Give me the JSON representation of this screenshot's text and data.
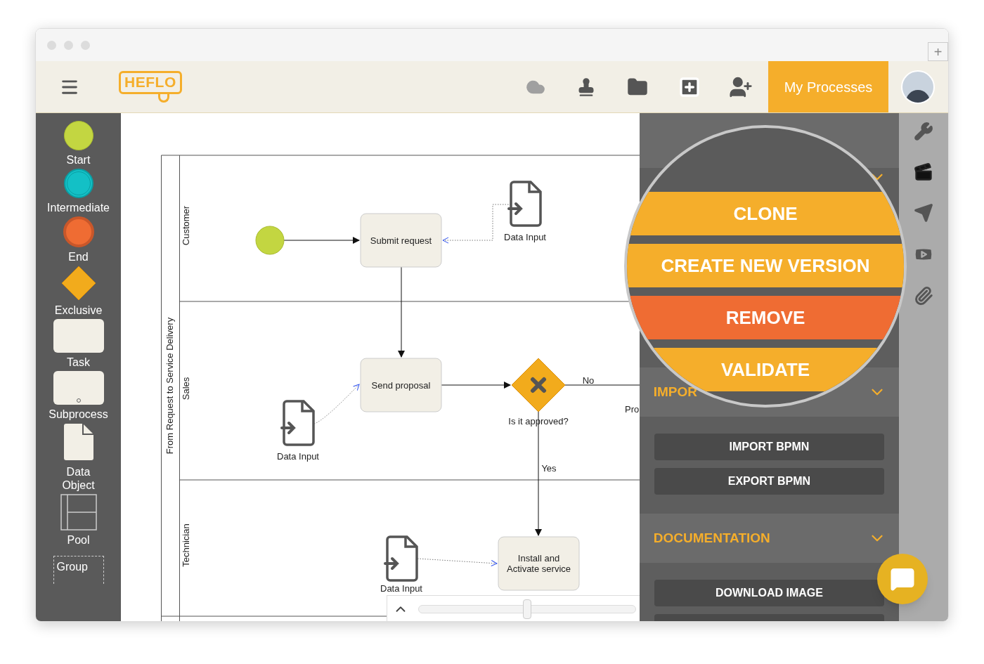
{
  "window": {
    "new_tab": "+"
  },
  "header": {
    "logo": "HEFLO",
    "primary_button": "My Processes"
  },
  "palette": [
    {
      "kind": "start",
      "label": "Start"
    },
    {
      "kind": "intermediate",
      "label": "Intermediate"
    },
    {
      "kind": "end",
      "label": "End"
    },
    {
      "kind": "gateway",
      "label": "Exclusive"
    },
    {
      "kind": "task",
      "label": "Task"
    },
    {
      "kind": "subprocess",
      "label": "Subprocess"
    },
    {
      "kind": "data",
      "label": "Data Object"
    },
    {
      "kind": "pool",
      "label": "Pool"
    },
    {
      "kind": "group",
      "label": "Group"
    }
  ],
  "diagram": {
    "pool": "From Request to Service Delivery",
    "lanes": [
      "Customer",
      "Sales",
      "Technician"
    ],
    "nodes": [
      {
        "kind": "start"
      },
      {
        "kind": "task",
        "label": "Submit request"
      },
      {
        "kind": "data",
        "label": "Data Input"
      },
      {
        "kind": "task",
        "label": "Send proposal"
      },
      {
        "kind": "gateway",
        "label": "Is it approved?"
      },
      {
        "kind": "data",
        "label": "Data Input"
      },
      {
        "kind": "task",
        "label": "Install and Activate service"
      },
      {
        "kind": "data",
        "label": "Data Input"
      }
    ],
    "flow_labels": [
      "No",
      "Pro",
      "Yes"
    ],
    "zoom": {
      "level": 0.5
    }
  },
  "panel": {
    "magnifier_actions": [
      {
        "kind": "primary",
        "label": "CLONE"
      },
      {
        "kind": "primary",
        "label": "CREATE NEW VERSION"
      },
      {
        "kind": "danger",
        "label": "REMOVE"
      },
      {
        "kind": "primary",
        "label": "VALIDATE"
      }
    ],
    "sections": [
      {
        "title": "IMPOR",
        "buttons": [
          "IMPORT BPMN",
          "EXPORT BPMN"
        ]
      },
      {
        "title": "DOCUMENTATION",
        "buttons": [
          "DOWNLOAD IMAGE"
        ]
      }
    ]
  }
}
